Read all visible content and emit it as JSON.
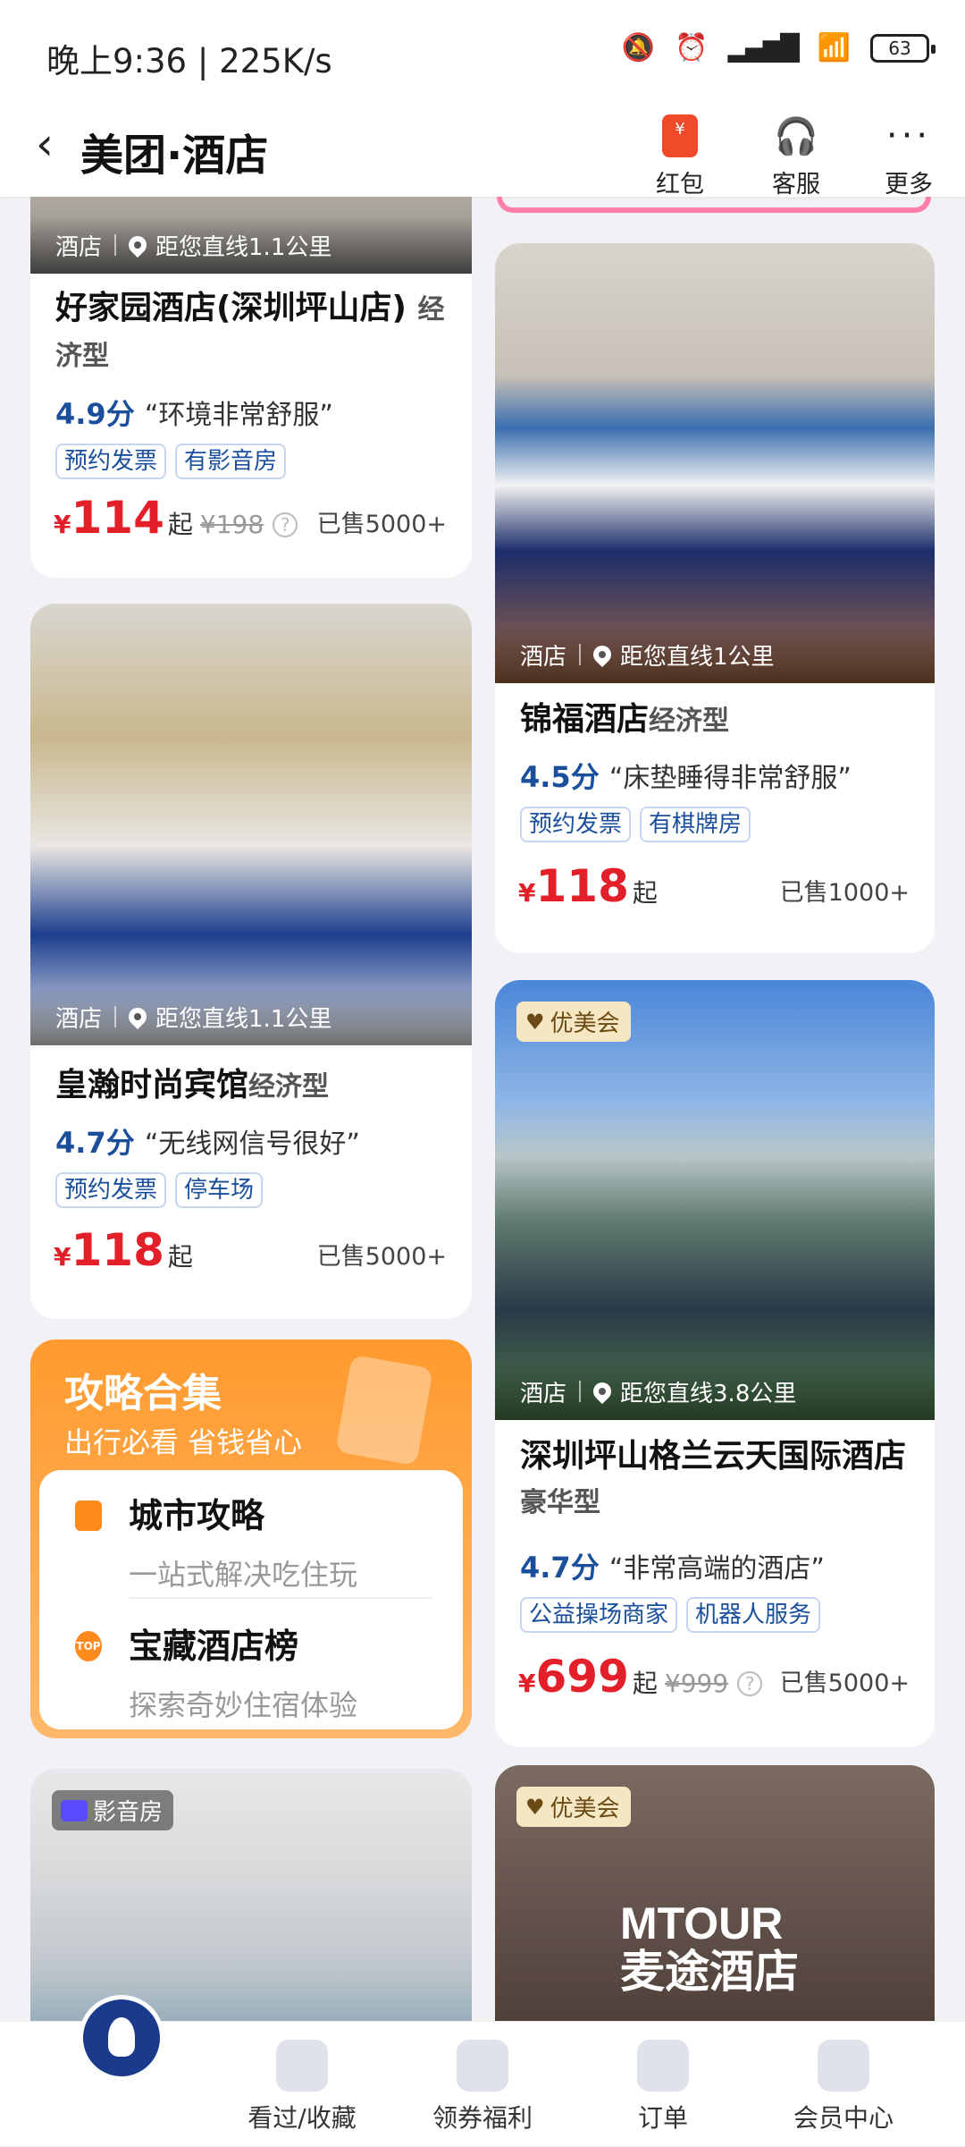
{
  "status": {
    "time": "晚上9:36 | 225K/s",
    "battery": "63"
  },
  "nav": {
    "title": "美团·酒店",
    "actions": [
      {
        "label": "红包",
        "icon": "red-packet-icon"
      },
      {
        "label": "客服",
        "icon": "headset-icon"
      },
      {
        "label": "更多",
        "icon": "more-dots-icon"
      }
    ],
    "redpack_glyph": "¥"
  },
  "hotels": {
    "h1": {
      "type": "酒店",
      "distance": "距您直线1.1公里",
      "name": "好家园酒店(深圳坪山店)",
      "level": "经济型",
      "score": "4.9分",
      "review": "“环境非常舒服”",
      "tags": [
        "预约发票",
        "有影音房"
      ],
      "currency": "¥",
      "price": "114",
      "qi": "起",
      "original": "¥198",
      "sold": "已售5000+"
    },
    "h2": {
      "type": "酒店",
      "distance": "距您直线1.1公里",
      "name": "皇瀚时尚宾馆",
      "level": "经济型",
      "score": "4.7分",
      "review": "“无线网信号很好”",
      "tags": [
        "预约发票",
        "停车场"
      ],
      "currency": "¥",
      "price": "118",
      "qi": "起",
      "sold": "已售5000+"
    },
    "h3": {
      "type": "酒店",
      "distance": "距您直线1公里",
      "name": "锦福酒店",
      "level": "经济型",
      "score": "4.5分",
      "review": "“床垫睡得非常舒服”",
      "tags": [
        "预约发票",
        "有棋牌房"
      ],
      "currency": "¥",
      "price": "118",
      "qi": "起",
      "sold": "已售1000+"
    },
    "h4": {
      "badge": "优美会",
      "type": "酒店",
      "distance": "距您直线3.8公里",
      "name": "深圳坪山格兰云天国际酒店",
      "level": "豪华型",
      "score": "4.7分",
      "review": "“非常高端的酒店”",
      "tags": [
        "公益操场商家",
        "机器人服务"
      ],
      "currency": "¥",
      "price": "699",
      "qi": "起",
      "original": "¥999",
      "sold": "已售5000+"
    },
    "h5": {
      "badge": "影音房"
    },
    "h6": {
      "badge": "优美会",
      "sign_text": "MTOUR",
      "sign_cn": "麦途酒店"
    }
  },
  "guide": {
    "title": "攻略合集",
    "subtitle": "出行必看 省钱省心",
    "items": [
      {
        "name": "城市攻略",
        "desc": "一站式解决吃住玩"
      },
      {
        "name": "宝藏酒店榜",
        "desc": "探索奇妙住宿体验"
      }
    ],
    "top_label": "TOP"
  },
  "tabbar": [
    {
      "label": "看过/收藏"
    },
    {
      "label": "领券福利"
    },
    {
      "label": "订单"
    },
    {
      "label": "会员中心"
    }
  ]
}
